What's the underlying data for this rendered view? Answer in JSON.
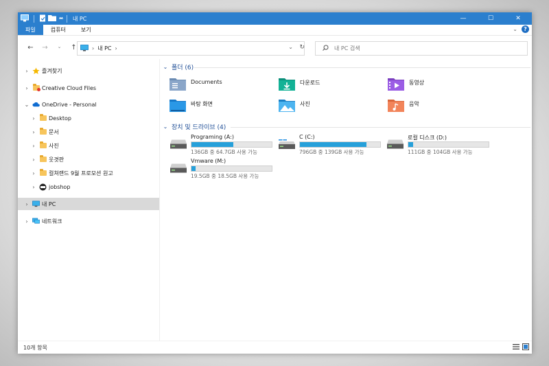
{
  "window": {
    "title": "내 PC"
  },
  "ribbon": {
    "tabs": [
      {
        "label": "파일",
        "active": true
      },
      {
        "label": "컴퓨터",
        "active": false
      },
      {
        "label": "보기",
        "active": false
      }
    ]
  },
  "address": {
    "location": "내 PC"
  },
  "search": {
    "placeholder": "내 PC 검색"
  },
  "sidebar": {
    "items": [
      {
        "label": "즐겨찾기"
      },
      {
        "label": "Creative Cloud Files"
      },
      {
        "label": "OneDrive - Personal"
      },
      {
        "label": "Desktop"
      },
      {
        "label": "문서"
      },
      {
        "label": "사진"
      },
      {
        "label": "웃겻판"
      },
      {
        "label": "컬쳐랜드 9월 프로모션 원고"
      },
      {
        "label": "jobshop"
      },
      {
        "label": "내 PC"
      },
      {
        "label": "네트워크"
      }
    ]
  },
  "folders": {
    "header": "폴더 (6)",
    "items": [
      {
        "name": "Documents"
      },
      {
        "name": "다운로드"
      },
      {
        "name": "동영상"
      },
      {
        "name": "바탕 화면"
      },
      {
        "name": "사진"
      },
      {
        "name": "음악"
      }
    ]
  },
  "drives": {
    "header": "장치 및 드라이브 (4)",
    "items": [
      {
        "name": "Programing (A:)",
        "info": "136GB 중 64.7GB 사용 가능",
        "used_fraction": 0.52
      },
      {
        "name": "C (C:)",
        "info": "796GB 중 139GB 사용 가능",
        "used_fraction": 0.83
      },
      {
        "name": "로컬 디스크 (D:)",
        "info": "111GB 중 104GB 사용 가능",
        "used_fraction": 0.06
      },
      {
        "name": "Vmware (M:)",
        "info": "19.5GB 중 18.5GB 사용 가능",
        "used_fraction": 0.05
      }
    ]
  },
  "status": {
    "item_count": "10개 항목"
  },
  "colors": {
    "accent": "#2b7fce",
    "drive_fill": "#26a0da",
    "group_header": "#1f4e96",
    "selection": "#d9d9d9"
  }
}
